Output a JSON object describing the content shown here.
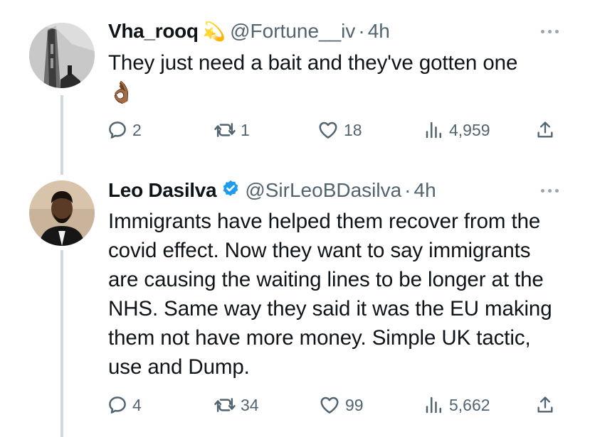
{
  "tweets": [
    {
      "name": "Vha_rooq",
      "name_emoji": "💫",
      "handle": "@Fortune__iv",
      "separator": "·",
      "time": "4h",
      "text": "They just need a bait and they've gotten one",
      "text_emoji": "👌🏾",
      "replies": "2",
      "retweets": "1",
      "likes": "18",
      "views": "4,959",
      "verified": false
    },
    {
      "name": "Leo Dasilva",
      "handle": "@SirLeoBDasilva",
      "separator": "·",
      "time": "4h",
      "text": "Immigrants have helped them recover from the covid effect. Now they want to say immigrants are causing the waiting lines to be longer at the NHS. Same way they said it was the EU making them not have more money. Simple UK tactic, use and Dump.",
      "replies": "4",
      "retweets": "34",
      "likes": "99",
      "views": "5,662",
      "verified": true
    }
  ],
  "colors": {
    "text": "#0f1419",
    "muted": "#536471",
    "thread_line": "#cfd9de",
    "verified": "#1d9bf0",
    "icon": "#536471"
  }
}
